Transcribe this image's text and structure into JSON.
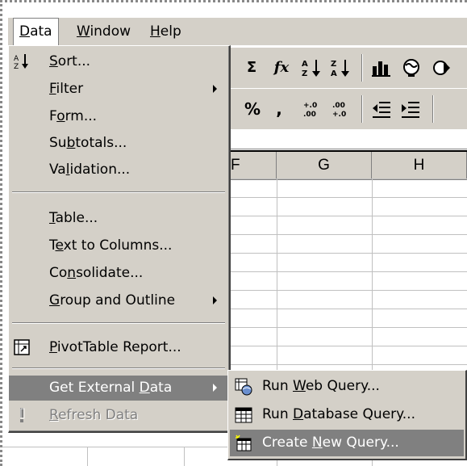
{
  "menubar": {
    "items": [
      {
        "label": "Data",
        "accel": "D"
      },
      {
        "label": "Window",
        "accel": "W"
      },
      {
        "label": "Help",
        "accel": "H"
      }
    ]
  },
  "toolbar1": [
    "Σ",
    "fx",
    "A→Z",
    "Z→A",
    "chart-wizard",
    "map"
  ],
  "toolbar2": [
    "%",
    ",",
    "+.0 .00",
    ".00 +.0",
    "decrease-indent",
    "increase-indent"
  ],
  "columns": [
    "F",
    "G",
    "H"
  ],
  "data_menu": {
    "items": [
      {
        "pre": "",
        "accel": "S",
        "post": "ort...",
        "submenu": false
      },
      {
        "pre": "",
        "accel": "F",
        "post": "ilter",
        "submenu": true
      },
      {
        "pre": "F",
        "accel": "o",
        "post": "rm...",
        "submenu": false
      },
      {
        "pre": "Su",
        "accel": "b",
        "post": "totals...",
        "submenu": false
      },
      {
        "pre": "Va",
        "accel": "l",
        "post": "idation...",
        "submenu": false
      },
      {
        "pre": "",
        "accel": "T",
        "post": "able...",
        "submenu": false
      },
      {
        "pre": "T",
        "accel": "e",
        "post": "xt to Columns...",
        "submenu": false
      },
      {
        "pre": "Co",
        "accel": "n",
        "post": "solidate...",
        "submenu": false
      },
      {
        "pre": "",
        "accel": "G",
        "post": "roup and Outline",
        "submenu": true
      },
      {
        "pre": "",
        "accel": "P",
        "post": "ivotTable Report...",
        "submenu": false
      },
      {
        "pre": "Get External ",
        "accel": "D",
        "post": "ata",
        "submenu": true,
        "highlighted": true
      },
      {
        "pre": "",
        "accel": "R",
        "post": "efresh Data",
        "submenu": false,
        "disabled": true
      }
    ]
  },
  "external_submenu": {
    "items": [
      {
        "pre": "Run ",
        "accel": "W",
        "post": "eb Query..."
      },
      {
        "pre": "Run ",
        "accel": "D",
        "post": "atabase Query..."
      },
      {
        "pre": "Create ",
        "accel": "N",
        "post": "ew Query...",
        "highlighted": true
      }
    ]
  },
  "colors": {
    "menu_bg": "#d4d0c8",
    "highlight": "#808080",
    "disabled": "#808080"
  }
}
